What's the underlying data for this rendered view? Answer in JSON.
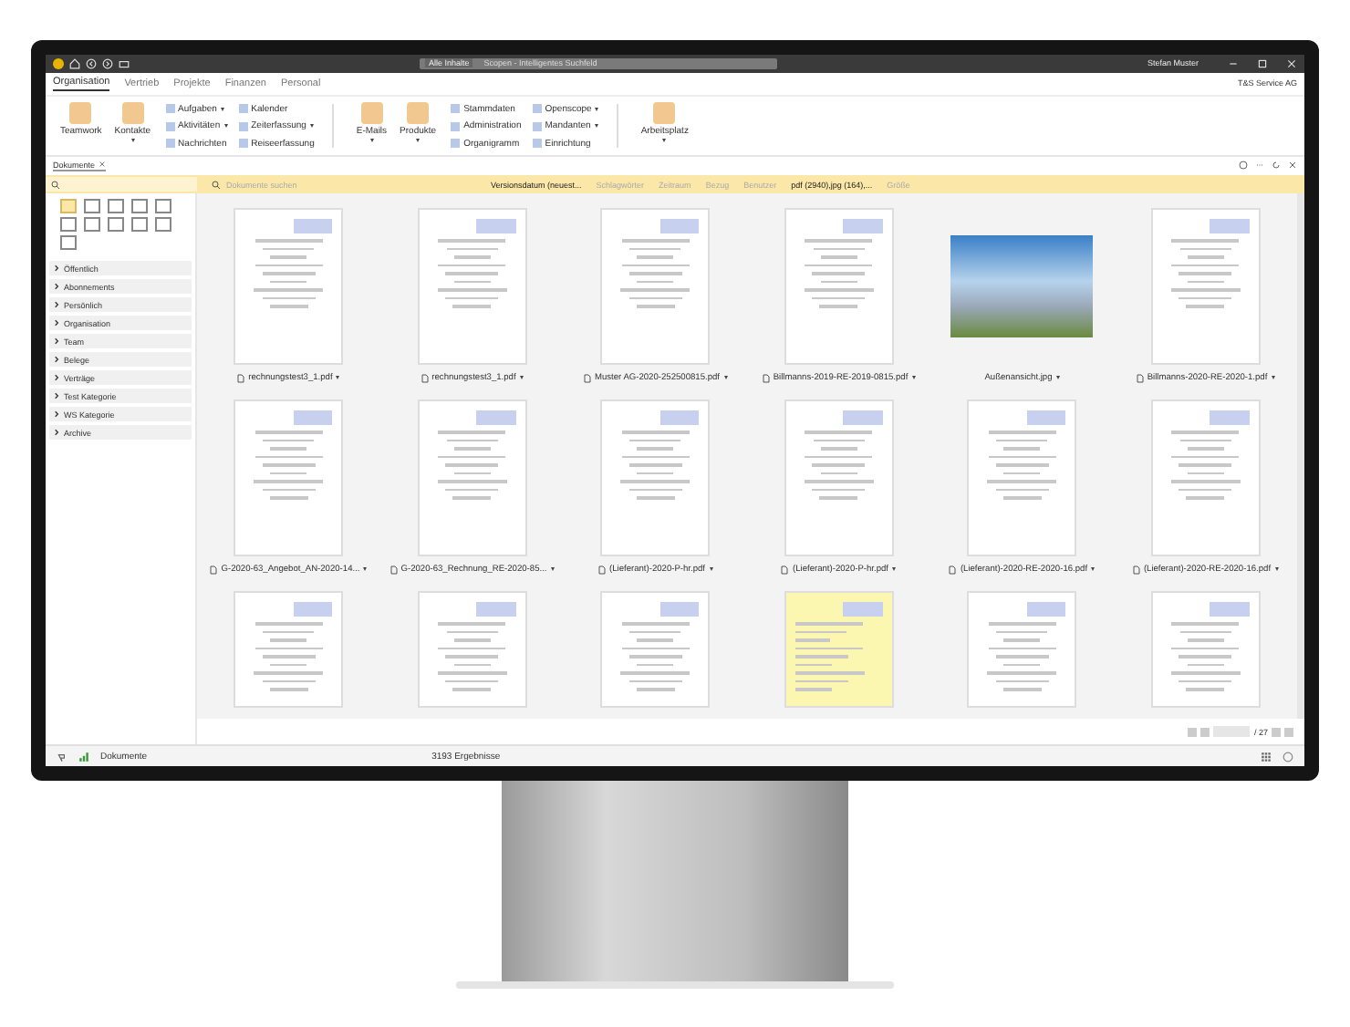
{
  "title_bar": {
    "scope": "Alle Inhalte",
    "search_placeholder": "Scopen - Intelligentes Suchfeld",
    "user": "Stefan Muster"
  },
  "menu_tabs": [
    {
      "label": "Organisation",
      "selected": true
    },
    {
      "label": "Vertrieb",
      "selected": false
    },
    {
      "label": "Projekte",
      "selected": false
    },
    {
      "label": "Finanzen",
      "selected": false
    },
    {
      "label": "Personal",
      "selected": false
    }
  ],
  "company": "T&S Service AG",
  "ribbon": [
    {
      "kind": "large",
      "items": [
        {
          "label": "Teamwork",
          "dropdown": false
        },
        {
          "label": "Kontakte",
          "dropdown": true
        }
      ]
    },
    {
      "kind": "small",
      "items": [
        {
          "label": "Aufgaben",
          "dropdown": true
        },
        {
          "label": "Aktivitäten",
          "dropdown": true
        },
        {
          "label": "Nachrichten",
          "dropdown": false
        }
      ]
    },
    {
      "kind": "small",
      "items": [
        {
          "label": "Kalender",
          "dropdown": false
        },
        {
          "label": "Zeiterfassung",
          "dropdown": true
        },
        {
          "label": "Reiseerfassung",
          "dropdown": false
        }
      ]
    },
    {
      "kind": "separator"
    },
    {
      "kind": "large",
      "items": [
        {
          "label": "E-Mails",
          "dropdown": true
        },
        {
          "label": "Produkte",
          "dropdown": true
        }
      ]
    },
    {
      "kind": "small",
      "items": [
        {
          "label": "Stammdaten",
          "dropdown": false
        },
        {
          "label": "Administration",
          "dropdown": false
        },
        {
          "label": "Organigramm",
          "dropdown": false
        }
      ]
    },
    {
      "kind": "small",
      "items": [
        {
          "label": "Openscope",
          "dropdown": true
        },
        {
          "label": "Mandanten",
          "dropdown": true
        },
        {
          "label": "Einrichtung",
          "dropdown": false
        }
      ]
    },
    {
      "kind": "separator"
    },
    {
      "kind": "large",
      "items": [
        {
          "label": "Arbeitsplatz",
          "dropdown": true
        }
      ]
    }
  ],
  "document_tabs": [
    {
      "label": "Dokumente",
      "selected": true
    }
  ],
  "filter_bar": {
    "search_placeholder": "Dokumente suchen",
    "filters": [
      {
        "label": "Versionsdatum (neuest...",
        "active": true
      },
      {
        "label": "Schlagwörter",
        "active": false
      },
      {
        "label": "Zeitraum",
        "active": false
      },
      {
        "label": "Bezug",
        "active": false
      },
      {
        "label": "Benutzer",
        "active": false
      },
      {
        "label": "pdf (2940),jpg (164),...",
        "active": true
      },
      {
        "label": "Größe",
        "active": false
      }
    ]
  },
  "sidebar": {
    "categories": [
      {
        "label": "Öffentlich",
        "expanded": false
      },
      {
        "label": "Abonnements",
        "expanded": false
      },
      {
        "label": "Persönlich",
        "expanded": false
      },
      {
        "label": "Organisation",
        "expanded": false
      },
      {
        "label": "Team",
        "expanded": false
      },
      {
        "label": "Belege",
        "expanded": false
      },
      {
        "label": "Verträge",
        "expanded": false
      },
      {
        "label": "Test Kategorie",
        "expanded": false
      },
      {
        "label": "WS Kategorie",
        "expanded": false
      },
      {
        "label": "Archive",
        "expanded": false
      }
    ]
  },
  "documents": [
    {
      "kind": "page",
      "label": "rechnungstest3_1.pdf"
    },
    {
      "kind": "page",
      "label": "rechnungstest3_1.pdf"
    },
    {
      "kind": "page",
      "label": "Muster AG-2020-252500815.pdf"
    },
    {
      "kind": "page",
      "label": "Billmanns-2019-RE-2019-0815.pdf"
    },
    {
      "kind": "photo",
      "label": "Außenansicht.jpg"
    },
    {
      "kind": "page",
      "label": "Billmanns-2020-RE-2020-1.pdf"
    },
    {
      "kind": "page",
      "label": "G-2020-63_Angebot_AN-2020-14..."
    },
    {
      "kind": "page",
      "label": "G-2020-63_Rechnung_RE-2020-85..."
    },
    {
      "kind": "page",
      "label": "(Lieferant)-2020-P-hr.pdf"
    },
    {
      "kind": "page",
      "label": "(Lieferant)-2020-P-hr.pdf"
    },
    {
      "kind": "page",
      "label": "(Lieferant)-2020-RE-2020-16.pdf"
    },
    {
      "kind": "page",
      "label": "(Lieferant)-2020-RE-2020-16.pdf"
    },
    {
      "kind": "page"
    },
    {
      "kind": "page"
    },
    {
      "kind": "page"
    },
    {
      "kind": "tinted-page"
    },
    {
      "kind": "page"
    },
    {
      "kind": "page"
    }
  ],
  "pagination": {
    "total": "/ 27"
  },
  "status_bar": {
    "view": "Dokumente",
    "results": "3193 Ergebnisse"
  }
}
